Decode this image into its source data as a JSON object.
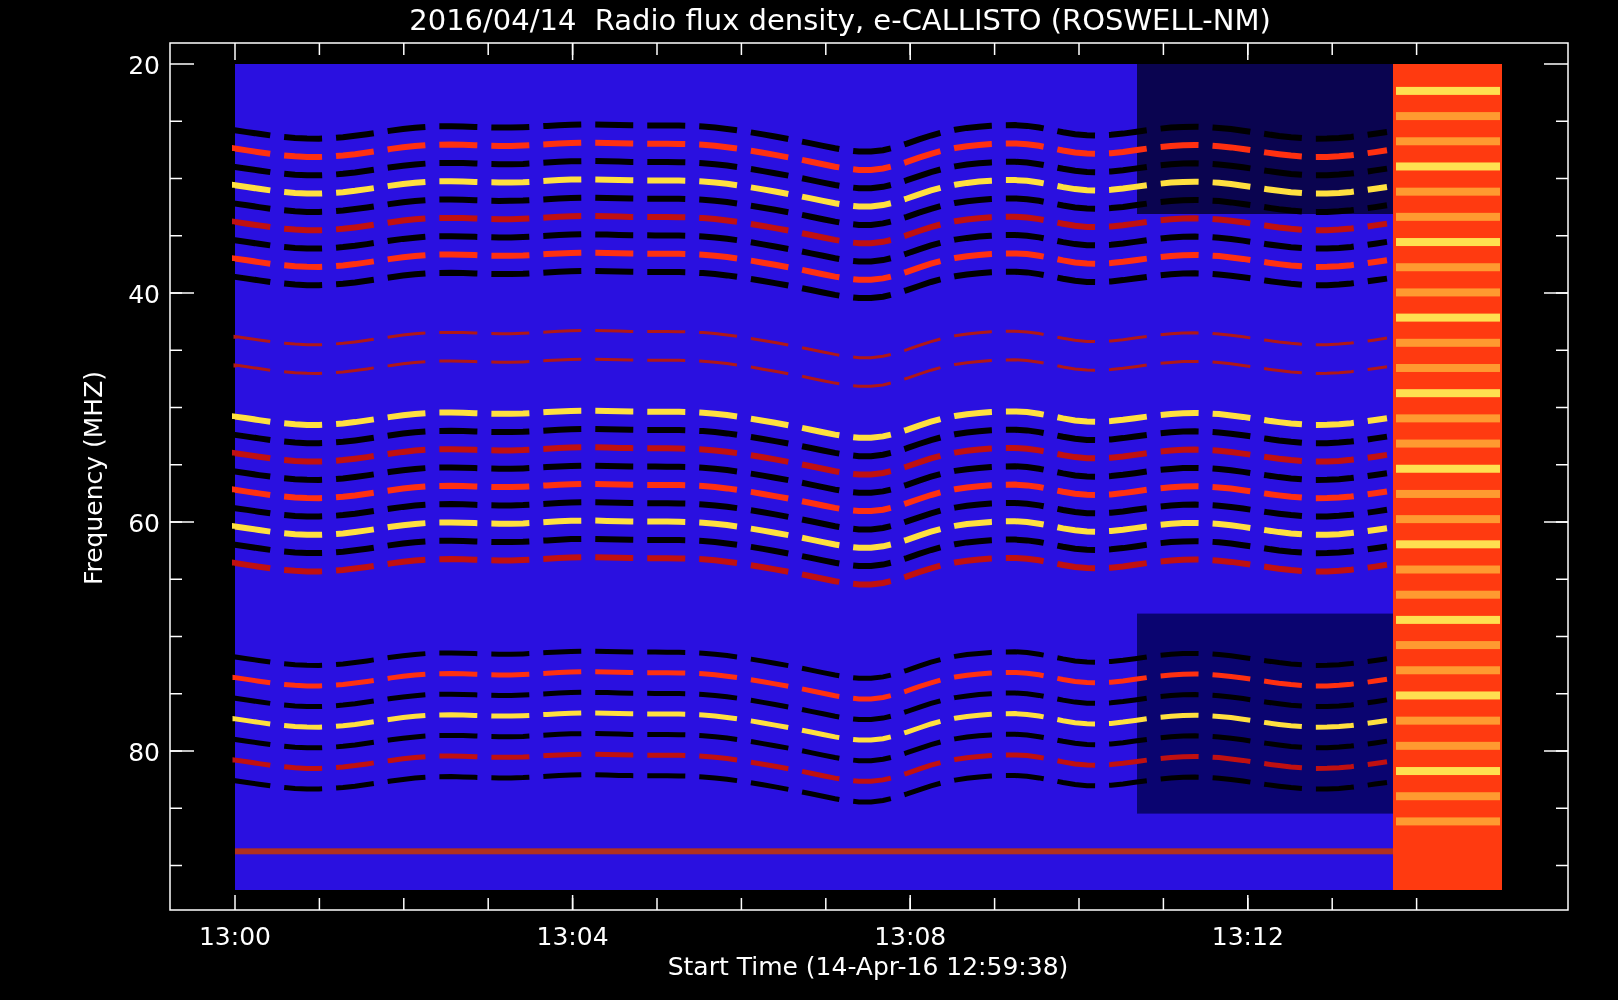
{
  "title": "2016/04/14  Radio flux density, e-CALLISTO (ROSWELL-NM)",
  "y_axis": {
    "label": "Frequency (MHZ)",
    "ticks": [
      "20",
      "40",
      "60",
      "80"
    ]
  },
  "x_axis": {
    "label": "Start Time (14-Apr-16 12:59:38)",
    "ticks": [
      "13:00",
      "13:04",
      "13:08",
      "13:12"
    ]
  }
}
